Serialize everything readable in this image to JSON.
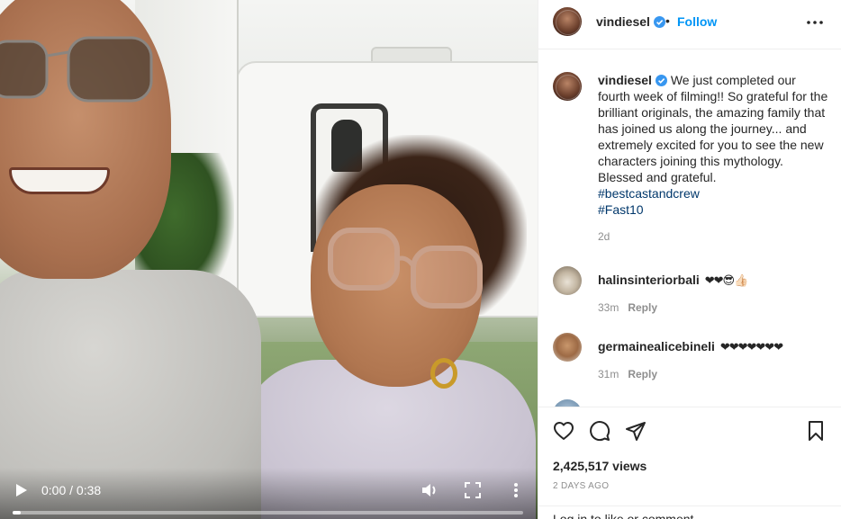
{
  "post": {
    "username": "vindiesel",
    "follow_label": "Follow",
    "dot_separator": "•",
    "caption_text": "We just completed our fourth week of filming!! So grateful for the brilliant originals, the amazing family that has joined us along the journey... and extremely excited for you to see the new characters joining this mythology. Blessed and grateful.",
    "hashtags": [
      "#bestcastandcrew",
      "#Fast10"
    ],
    "caption_time": "2d"
  },
  "comments": [
    {
      "username": "halinsinteriorbali",
      "text": "❤❤😎👍🏻",
      "time": "33m",
      "reply_label": "Reply"
    },
    {
      "username": "germainealicebineli",
      "text": "❤❤❤❤❤❤❤",
      "time": "31m",
      "reply_label": "Reply"
    }
  ],
  "video": {
    "time_display": "0:00 / 0:38",
    "progress_fraction": 0.0
  },
  "stats": {
    "views": "2,425,517 views",
    "posted": "2 DAYS AGO"
  },
  "footer": {
    "login_text": "Log in to like or comment."
  },
  "colors": {
    "link_blue": "#0095f6",
    "hashtag_blue": "#00376b",
    "verified_blue": "#3897f0",
    "muted_gray": "#8e8e8e"
  },
  "icons": {
    "play": "play-icon",
    "volume": "volume-icon",
    "fullscreen": "fullscreen-icon",
    "more": "more-vertical-icon",
    "header_more": "more-horizontal-icon",
    "like": "heart-icon",
    "comment": "comment-icon",
    "share": "share-icon",
    "save": "bookmark-icon",
    "verified": "verified-badge-icon"
  }
}
